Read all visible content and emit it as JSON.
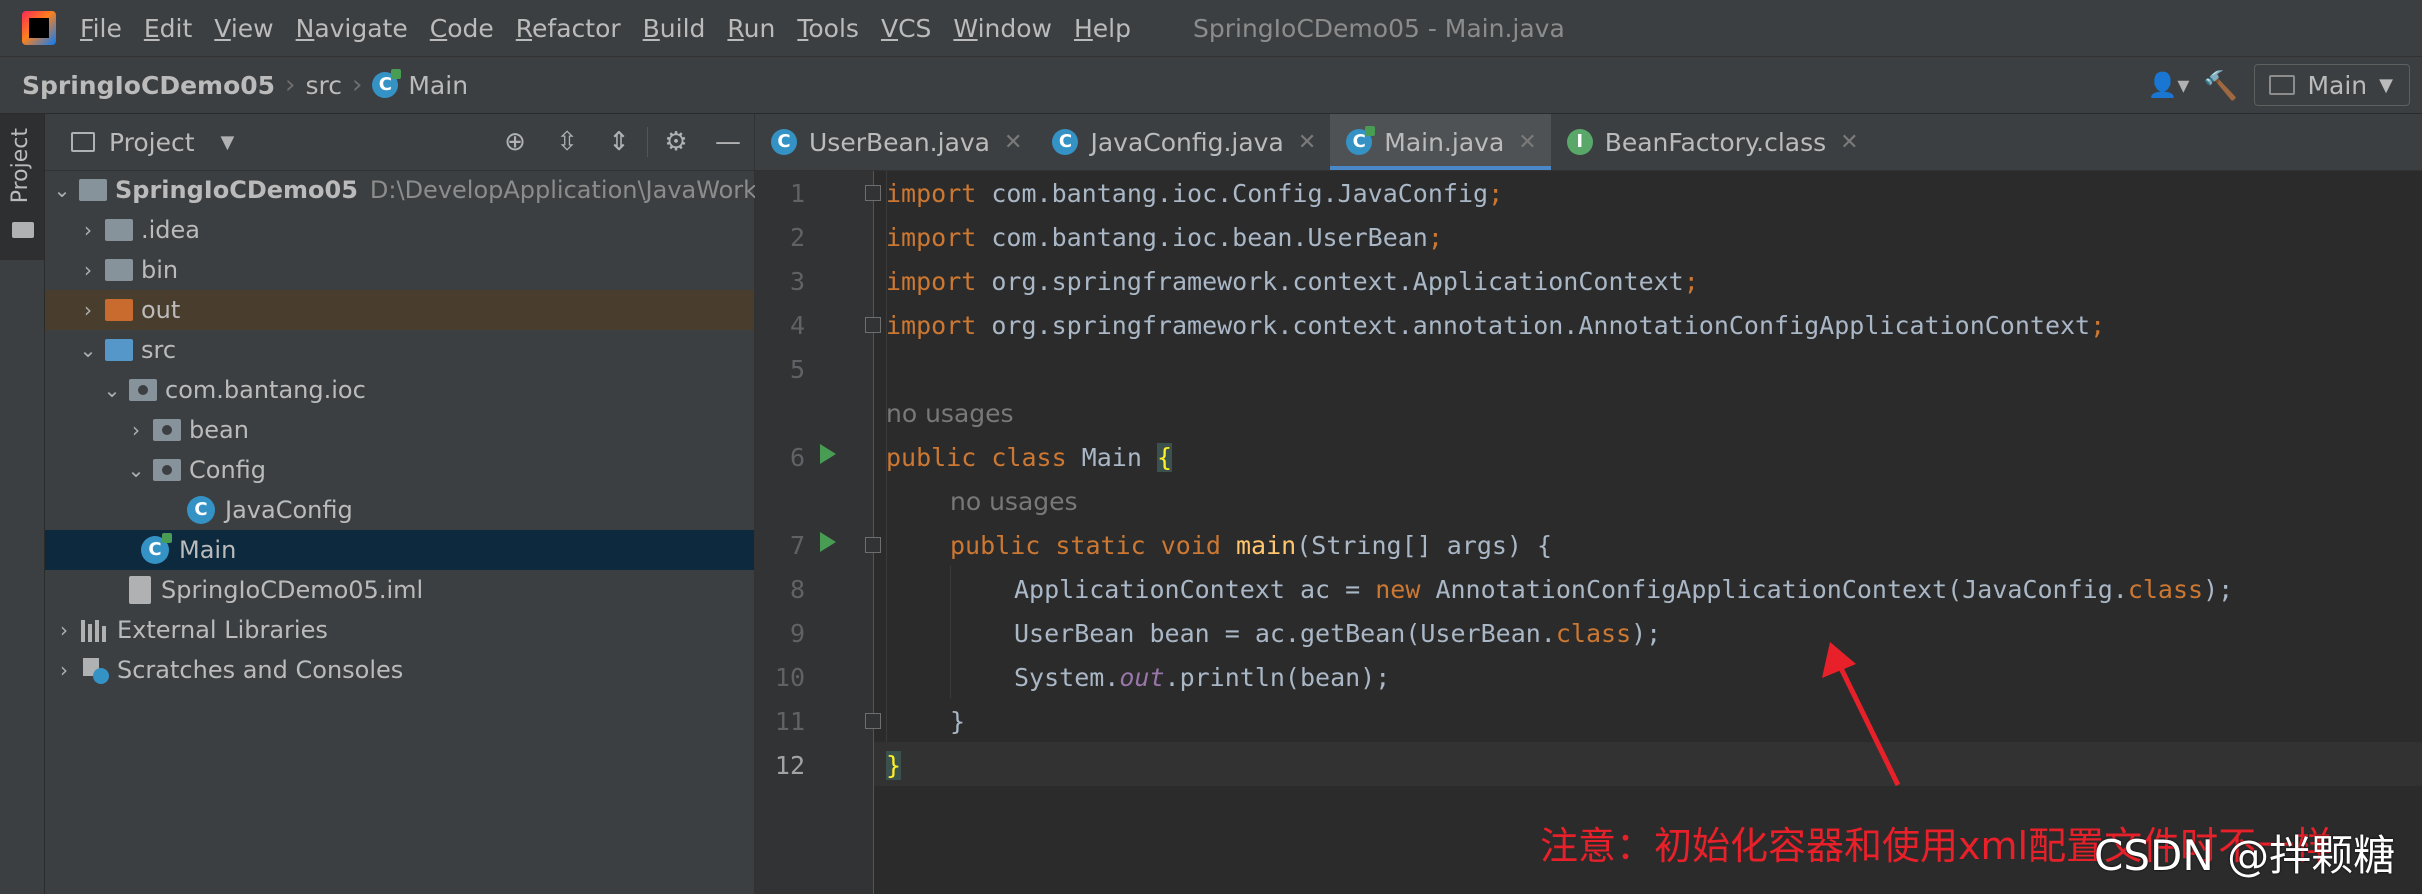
{
  "window": {
    "title": "SpringIoCDemo05 - Main.java"
  },
  "menu": [
    {
      "mnemonic": "F",
      "rest": "ile"
    },
    {
      "mnemonic": "E",
      "rest": "dit"
    },
    {
      "mnemonic": "V",
      "rest": "iew"
    },
    {
      "mnemonic": "N",
      "rest": "avigate"
    },
    {
      "mnemonic": "C",
      "rest": "ode"
    },
    {
      "mnemonic": "R",
      "rest": "efactor"
    },
    {
      "mnemonic": "B",
      "rest": "uild"
    },
    {
      "mnemonic": "R",
      "rest": "un"
    },
    {
      "mnemonic": "T",
      "rest": "ools"
    },
    {
      "mnemonic": "V",
      "rest": "CS"
    },
    {
      "mnemonic": "W",
      "rest": "indow"
    },
    {
      "mnemonic": "H",
      "rest": "elp"
    }
  ],
  "breadcrumb": {
    "project": "SpringIoCDemo05",
    "folder": "src",
    "file": "Main"
  },
  "run_config": {
    "label": "Main"
  },
  "side_strip": {
    "project_tab": "Project"
  },
  "project_panel": {
    "title": "Project",
    "caret": "▾"
  },
  "tree": {
    "root": {
      "name": "SpringIoCDemo05",
      "path": "D:\\DevelopApplication\\JavaWorkS"
    },
    "idea": ".idea",
    "bin": "bin",
    "out": "out",
    "src": "src",
    "pkg": "com.bantang.ioc",
    "bean": "bean",
    "config": "Config",
    "javaconfig": "JavaConfig",
    "main": "Main",
    "iml": "SpringIoCDemo05.iml",
    "external": "External Libraries",
    "scratches": "Scratches and Consoles"
  },
  "tabs": [
    {
      "label": "UserBean.java",
      "icon": "C"
    },
    {
      "label": "JavaConfig.java",
      "icon": "C"
    },
    {
      "label": "Main.java",
      "icon": "C"
    },
    {
      "label": "BeanFactory.class",
      "icon": "I"
    }
  ],
  "editor": {
    "line_numbers": [
      "1",
      "2",
      "3",
      "4",
      "5",
      "6",
      "7",
      "8",
      "9",
      "10",
      "11",
      "12"
    ],
    "hints": {
      "no_usages": "no usages"
    },
    "code": {
      "l1_kw": "import",
      "l1_rest": " com.bantang.ioc.Config.JavaConfig",
      "semi": ";",
      "l2_rest": " com.bantang.ioc.bean.UserBean",
      "l3_rest": " org.springframework.context.ApplicationContext",
      "l4_rest": " org.springframework.context.annotation.AnnotationConfigApplicationContext",
      "l6_public": "public",
      "l6_class": " class",
      "l6_name": " Main ",
      "l6_brace": "{",
      "l7_mods": "public static void",
      "l7_fn": "main",
      "l7_rest": "(String[] args) {",
      "l8_a": "ApplicationContext ac = ",
      "l8_new": "new",
      "l8_b": " AnnotationConfigApplicationContext(JavaConfig.",
      "l8_class": "class",
      "l8_c": ");",
      "l9_a": "UserBean bean = ac.getBean(UserBean.",
      "l9_class": "class",
      "l9_c": ");",
      "l10_a": "System.",
      "l10_out": "out",
      "l10_b": ".println(bean);",
      "l11": "}",
      "l12": "}"
    }
  },
  "annotation": {
    "text": "注意：初始化容器和使用xml配置文件时不一样"
  },
  "watermark": {
    "text": "CSDN @拌颗糖"
  },
  "colors": {
    "annotation": "#e8202a",
    "keyword": "#cc7832",
    "function": "#ffc66d",
    "selection": "#0d293e"
  }
}
